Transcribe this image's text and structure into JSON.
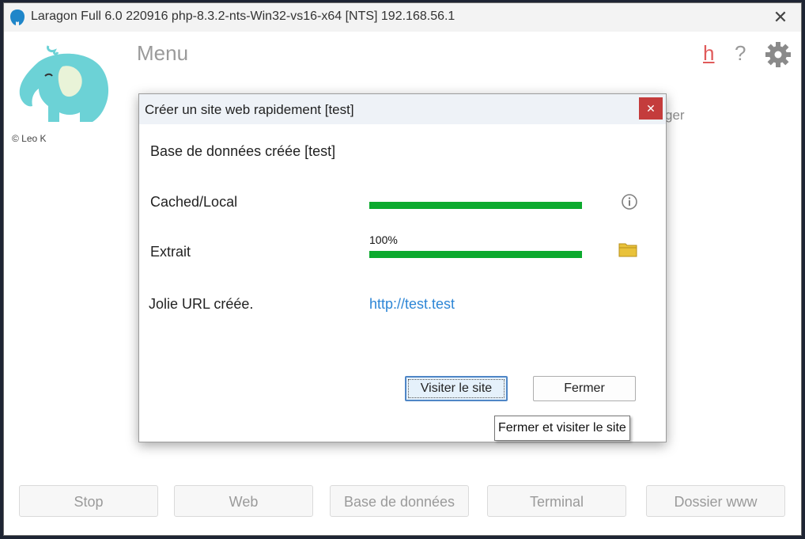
{
  "window": {
    "title": "Laragon Full 6.0 220916 php-8.3.2-nts-Win32-vs16-x64 [NTS]  192.168.56.1",
    "close_glyph": "✕"
  },
  "main": {
    "logo_icon": "elephant-icon",
    "copyright": "© Leo K",
    "menu_label": "Menu",
    "h_label": "h",
    "help_label": "?",
    "settings_icon": "gear-icon",
    "partial_text": "ger"
  },
  "bottom_buttons": {
    "stop": "Stop",
    "web": "Web",
    "database": "Base de données",
    "terminal": "Terminal",
    "www_folder": "Dossier www"
  },
  "dialog": {
    "title": "Créer un site web rapidement [test]",
    "close_glyph": "✕",
    "db_created": "Base de données créée [test]",
    "cached_label": "Cached/Local",
    "cached_progress": 100,
    "extract_label": "Extrait",
    "extract_percent_text": "100%",
    "extract_progress": 100,
    "pretty_url_label": "Jolie URL créée.",
    "url": "http://test.test",
    "visit_button": "Visiter le site",
    "close_button": "Fermer",
    "tooltip": "Fermer et visiter le site"
  },
  "colors": {
    "progress": "#0caa2e",
    "link": "#2d86d6",
    "dialog_close": "#c43c3c",
    "logo": "#6cd2d6"
  }
}
